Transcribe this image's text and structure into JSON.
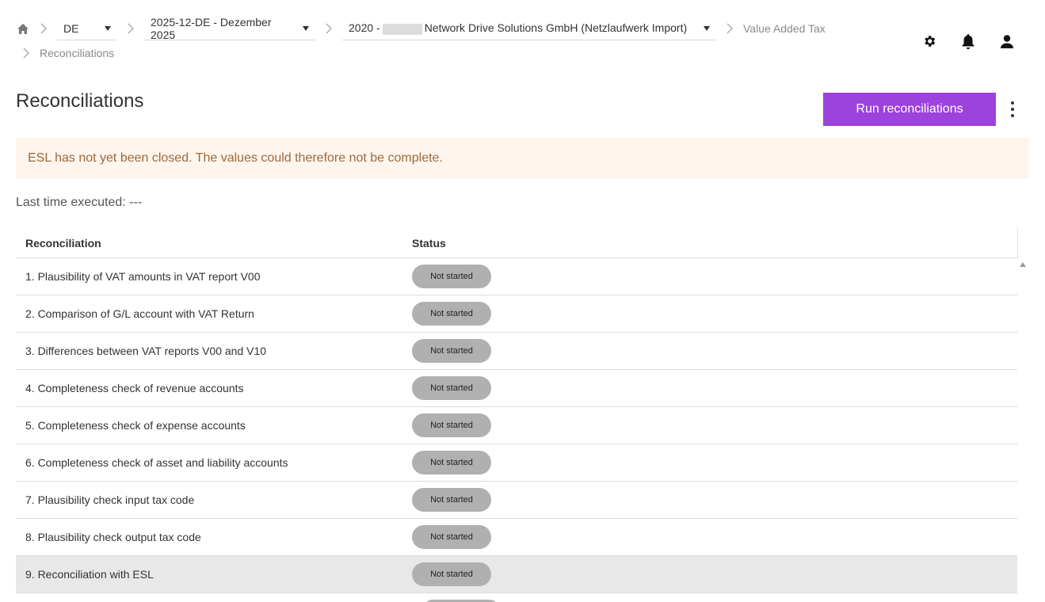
{
  "breadcrumb": {
    "country": "DE",
    "period": "2025-12-DE - Dezember 2025",
    "company_prefix": "2020 -",
    "company_name": "Network Drive Solutions GmbH (Netzlaufwerk Import)",
    "value_added_tax": "Value Added Tax",
    "reconciliations": "Reconciliations"
  },
  "header_icons": [
    "gear-icon",
    "bell-icon",
    "user-icon"
  ],
  "page": {
    "title": "Reconciliations",
    "run_button": "Run reconciliations",
    "banner": "ESL has not yet been closed. The values could therefore not be complete.",
    "last_executed": "Last time executed: ---"
  },
  "table": {
    "headers": {
      "reconciliation": "Reconciliation",
      "status": "Status"
    },
    "rows": [
      {
        "name": "1. Plausibility of VAT amounts in VAT report V00",
        "status": "Not started"
      },
      {
        "name": "2. Comparison of G/L account with VAT Return",
        "status": "Not started"
      },
      {
        "name": "3. Differences between VAT reports V00 and V10",
        "status": "Not started"
      },
      {
        "name": "4. Completeness check of revenue accounts",
        "status": "Not started"
      },
      {
        "name": "5. Completeness check of expense accounts",
        "status": "Not started"
      },
      {
        "name": "6. Completeness check of asset and liability accounts",
        "status": "Not started"
      },
      {
        "name": "7. Plausibility check input tax code",
        "status": "Not started"
      },
      {
        "name": "8. Plausibility check output tax code",
        "status": "Not started"
      },
      {
        "name": "9. Reconciliation with ESL",
        "status": "Not started"
      }
    ]
  },
  "colors": {
    "accent": "#9c42dd",
    "banner_bg": "#fef5ec",
    "banner_text": "#9a6a3f",
    "badge_bg": "#b0b0b0",
    "row_highlight": "#e8e8e8"
  }
}
